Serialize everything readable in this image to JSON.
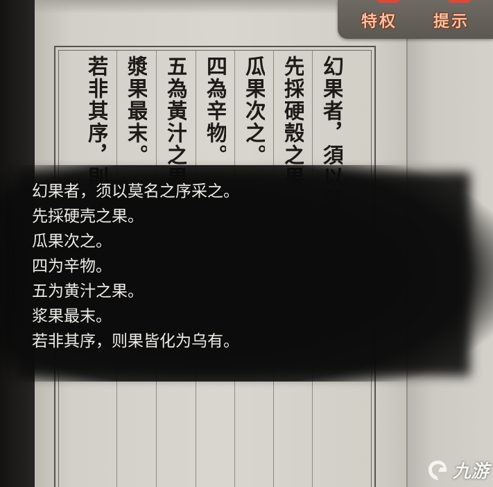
{
  "buttons": {
    "privilege_label": "特权",
    "hint_label": "提示"
  },
  "book": {
    "columns": [
      "幻果者，須以莫名之序采之。",
      "先採硬殼之果",
      "瓜果次之。",
      "四為辛物。",
      "五為黃汁之果",
      "漿果最末。",
      "若非其序，則"
    ]
  },
  "translation": {
    "lines": [
      "幻果者，须以莫名之序采之。",
      "先採硬壳之果。",
      "瓜果次之。",
      "四为辛物。",
      "五为黄汁之果。",
      "浆果最末。",
      "若非其序，则果皆化为乌有。"
    ]
  },
  "watermark": {
    "text": "九游"
  },
  "colors": {
    "button_text": "#f3c3a2",
    "button_bar": "#6f6a63",
    "paper": "#d8d6ce",
    "ink": "#1c1b19",
    "overlay_text": "#ecebe6"
  }
}
